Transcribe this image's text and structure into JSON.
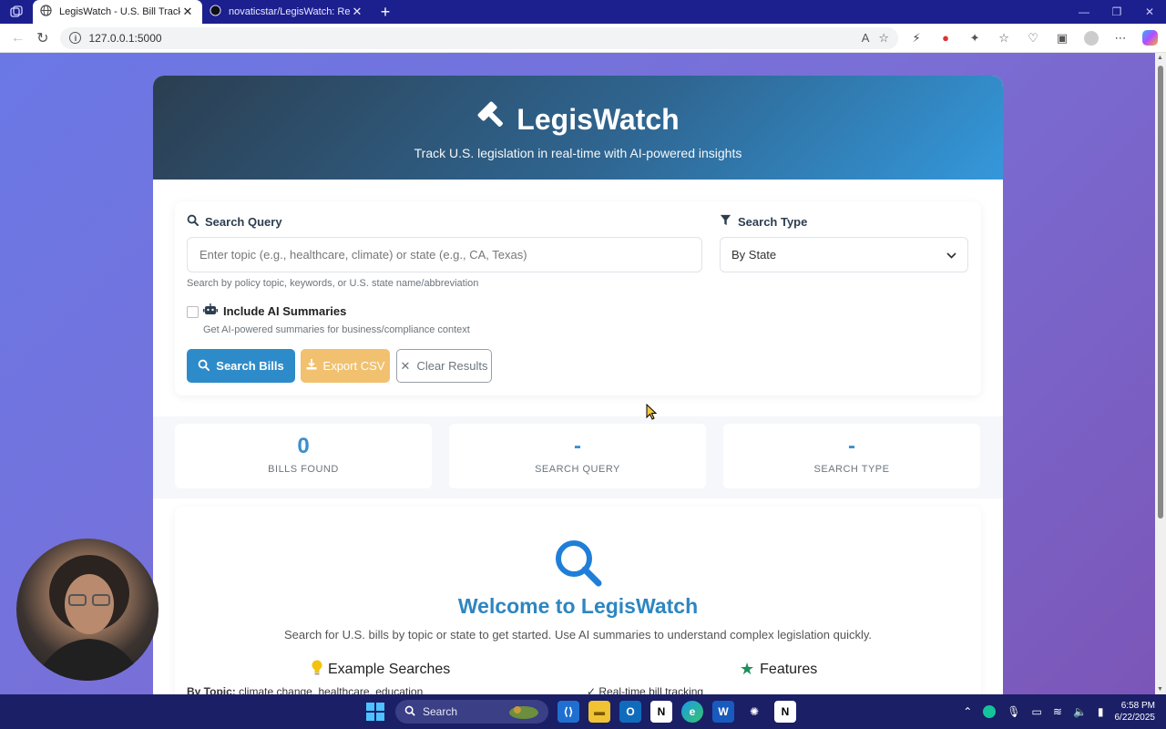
{
  "browser": {
    "tabs": [
      {
        "title": "LegisWatch - U.S. Bill Tracker",
        "active": true
      },
      {
        "title": "novaticstar/LegisWatch: Real-Tim",
        "active": false
      }
    ],
    "url": "127.0.0.1:5000"
  },
  "hero": {
    "title": "LegisWatch",
    "subtitle": "Track U.S. legislation in real-time with AI-powered insights"
  },
  "search": {
    "query_label": "Search Query",
    "query_placeholder": "Enter topic (e.g., healthcare, climate) or state (e.g., CA, Texas)",
    "query_help": "Search by policy topic, keywords, or U.S. state name/abbreviation",
    "type_label": "Search Type",
    "type_selected": "By State",
    "ai_label": "Include AI Summaries",
    "ai_help": "Get AI-powered summaries for business/compliance context",
    "buttons": {
      "search": "Search Bills",
      "export": "Export CSV",
      "clear": "Clear Results"
    }
  },
  "stats": [
    {
      "value": "0",
      "label": "BILLS FOUND"
    },
    {
      "value": "-",
      "label": "SEARCH QUERY"
    },
    {
      "value": "-",
      "label": "SEARCH TYPE"
    }
  ],
  "welcome": {
    "title": "Welcome to LegisWatch",
    "text": "Search for U.S. bills by topic or state to get started. Use AI summaries to understand complex legislation quickly.",
    "examples_title": "Example Searches",
    "examples_line_label": "By Topic:",
    "examples_line_value": "climate change, healthcare, education",
    "features_title": "Features",
    "features_line": "✓ Real-time bill tracking"
  },
  "taskbar": {
    "search_label": "Search",
    "time": "6:58 PM",
    "date": "6/22/2025"
  },
  "colors": {
    "accent": "#3498db",
    "header_dark": "#2c3e50",
    "export": "#efb757",
    "stat_number": "#3a8fd0"
  }
}
